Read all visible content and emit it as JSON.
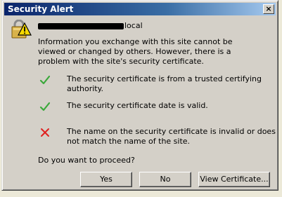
{
  "window": {
    "title": "Security Alert",
    "close_label": "×"
  },
  "site": {
    "suffix": "local"
  },
  "message": {
    "intro": "Information you exchange with this site cannot be viewed or changed by others. However, there is a problem with the site's security certificate."
  },
  "checks": [
    {
      "status": "ok",
      "icon": "check-icon",
      "text": "The security certificate is from a trusted certifying authority."
    },
    {
      "status": "ok",
      "icon": "check-icon",
      "text": "The security certificate date is valid."
    },
    {
      "status": "error",
      "icon": "x-icon",
      "text": "The name on the security certificate is invalid or does not match the name of the site."
    }
  ],
  "question": "Do you want to proceed?",
  "buttons": {
    "yes": "Yes",
    "no": "No",
    "view_certificate": "View Certificate..."
  },
  "colors": {
    "title_start": "#0a246a",
    "title_end": "#a6caf0",
    "check": "#3aa83a",
    "error": "#e02020",
    "warning": "#f5d800"
  }
}
